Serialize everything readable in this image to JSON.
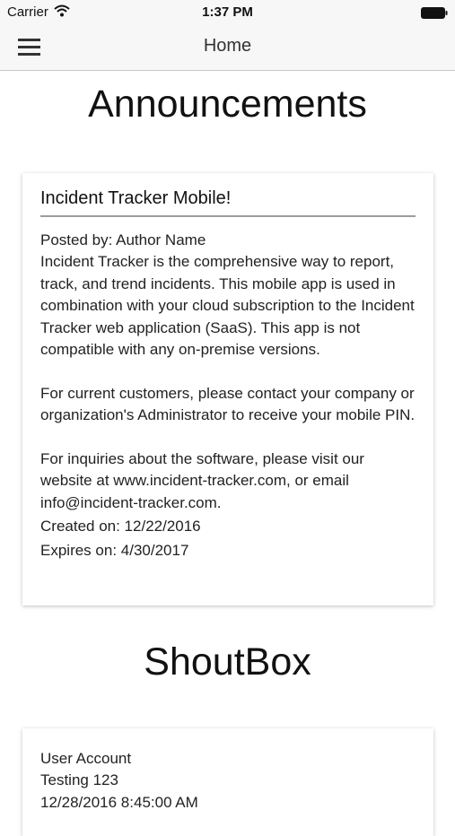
{
  "status_bar": {
    "carrier": "Carrier",
    "time": "1:37 PM"
  },
  "nav": {
    "title": "Home"
  },
  "announcements": {
    "section_title": "Announcements",
    "card": {
      "heading": "Incident Tracker Mobile!",
      "posted_by": "Posted by: Author Name",
      "paragraph_1": "Incident Tracker is the comprehensive way to report, track, and trend incidents. This mobile app is used in combination with your cloud subscription to the Incident Tracker web application (SaaS). This app is not compatible with any on-premise versions.",
      "paragraph_2": "For current customers, please contact your company or organization's Administrator to receive your mobile PIN.",
      "paragraph_3": "For inquiries about the software, please visit our website at www.incident-tracker.com, or email info@incident-tracker.com.",
      "created_on": "Created on: 12/22/2016",
      "expires_on": "Expires on: 4/30/2017"
    }
  },
  "shoutbox": {
    "section_title": "ShoutBox",
    "entries": [
      {
        "user": "User Account",
        "message": "Testing 123",
        "timestamp": "12/28/2016 8:45:00 AM"
      }
    ]
  }
}
